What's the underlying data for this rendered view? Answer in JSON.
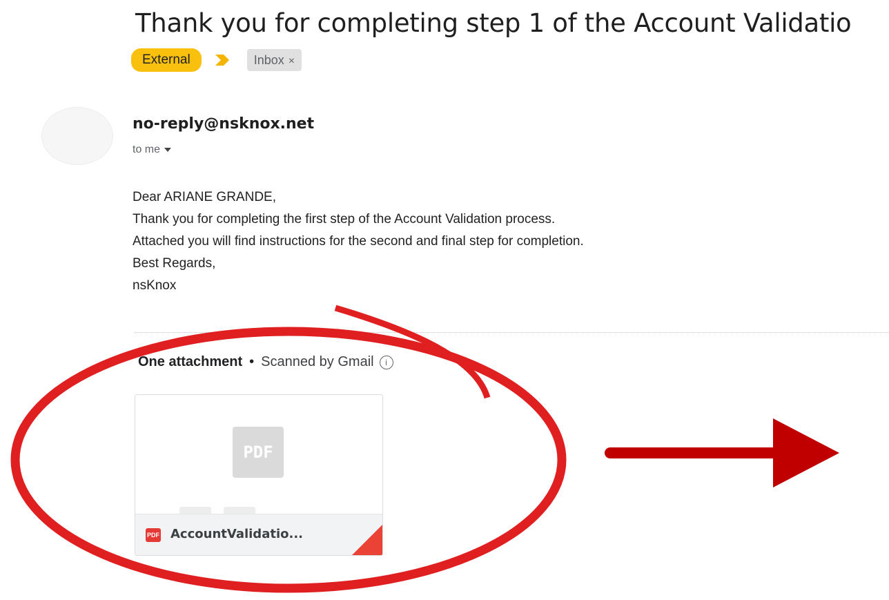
{
  "email": {
    "subject": "Thank you for completing step 1 of the Account Validatio",
    "labels": {
      "external": "External",
      "inbox": "Inbox",
      "inbox_remove": "×"
    },
    "sender": "no-reply@nsknox.net",
    "recipient": "to me",
    "body_lines": [
      "Dear ARIANE GRANDE,",
      "Thank you for completing the first step of the Account Validation process.",
      "Attached you will find instructions for the second and final step for completion.",
      "Best Regards,",
      "nsKnox"
    ]
  },
  "attachments": {
    "heading": "One attachment",
    "separator": "•",
    "scan_note": "Scanned by Gmail",
    "info_glyph": "i",
    "file": {
      "name": "AccountValidatio...",
      "type_badge": "PDF",
      "thumb_label": "PDF"
    }
  },
  "annotations": {
    "circle_color": "#e02020",
    "arrow_color": "#c00000"
  },
  "colors": {
    "external_label": "#f9c10e",
    "pdf_red": "#e53935"
  },
  "icons": [
    "importance-marker-icon",
    "info-icon",
    "pdf-file-icon",
    "caret-down-icon"
  ]
}
